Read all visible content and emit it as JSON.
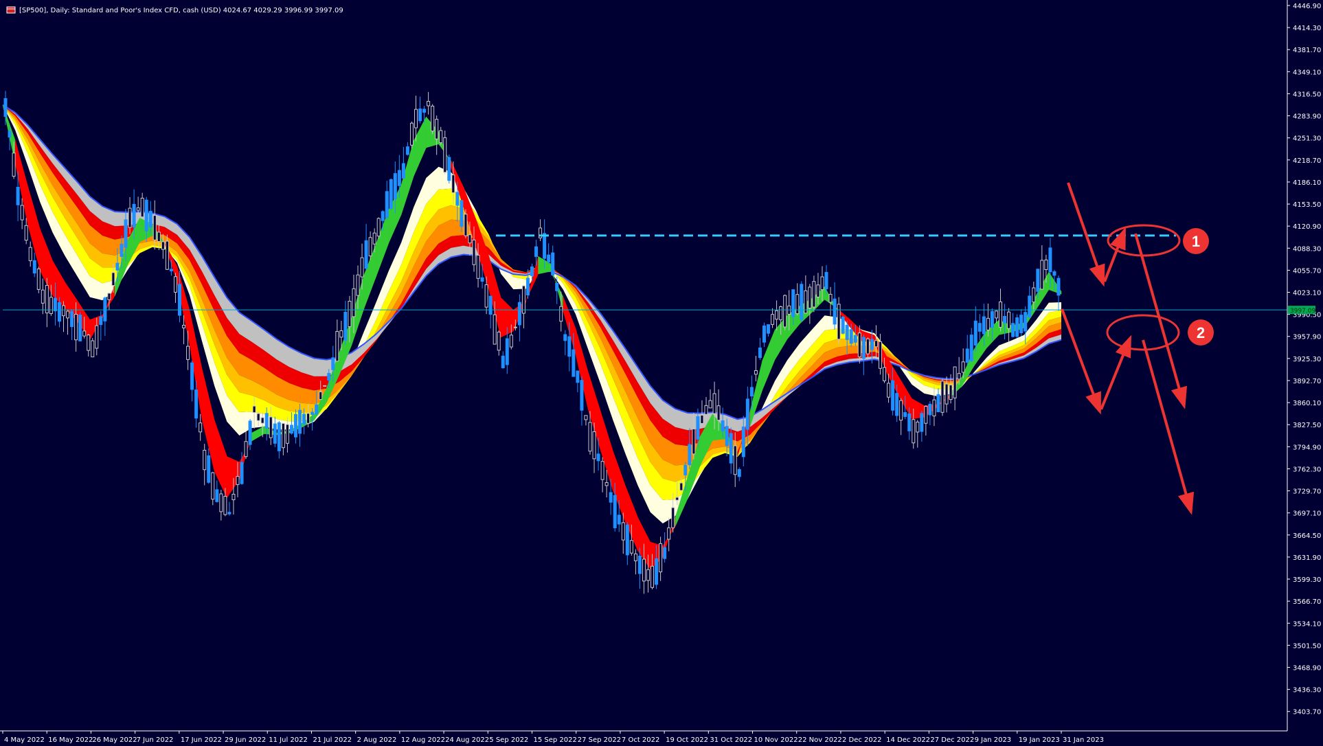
{
  "header": {
    "title": "[SP500], Daily:  Standard and Poor's Index CFD, cash (USD)  4024.67 4029.29 3996.99 3997.09",
    "flag_icon": "chart-window-icon"
  },
  "colors": {
    "background": "#000033",
    "bull_candle": "#1e90ff",
    "bear_candle": "#c8c8c8",
    "axis_text": "#ffffff",
    "cloud_red": "#ff0000",
    "cloud_green": "#33cc33",
    "cloud_pink": "#e040a0",
    "ribbon_gray": "#c0c0c0",
    "ribbon_red": "#ee0000",
    "ribbon_orange": "#ff8c00",
    "ribbon_amber": "#ffc000",
    "ribbon_yellow": "#ffff00",
    "ribbon_cream": "#ffffe0",
    "hline": "#00aacc",
    "dashed": "#33ccff",
    "annotation": "#ee3333",
    "price_tag": "#00aa55"
  },
  "chart_data": {
    "type": "candlestick",
    "symbol": "SP500",
    "timeframe": "Daily",
    "y_axis": {
      "ylim": [
        3375.0,
        4446.9
      ],
      "ticks": [
        "4446.90",
        "4414.30",
        "4381.70",
        "4349.10",
        "4316.50",
        "4283.90",
        "4251.30",
        "4218.70",
        "4186.10",
        "4153.50",
        "4120.90",
        "4088.30",
        "4055.70",
        "4023.10",
        "3990.50",
        "3957.90",
        "3925.30",
        "3892.70",
        "3860.10",
        "3827.50",
        "3794.90",
        "3762.30",
        "3729.70",
        "3697.10",
        "3664.50",
        "3631.90",
        "3599.30",
        "3566.70",
        "3534.10",
        "3501.50",
        "3468.90",
        "3436.30",
        "3403.70"
      ],
      "current_price_label": "3997.09"
    },
    "x_axis": {
      "ticks": [
        "4 May 2022",
        "16 May 2022",
        "26 May 2022",
        "7 Jun 2022",
        "17 Jun 2022",
        "29 Jun 2022",
        "11 Jul 2022",
        "21 Jul 2022",
        "2 Aug 2022",
        "12 Aug 2022",
        "24 Aug 2022",
        "5 Sep 2022",
        "15 Sep 2022",
        "27 Sep 2022",
        "7 Oct 2022",
        "19 Oct 2022",
        "31 Oct 2022",
        "10 Nov 2022",
        "22 Nov 2022",
        "2 Dec 2022",
        "14 Dec 2022",
        "27 Dec 2022",
        "9 Jan 2023",
        "19 Jan 2023",
        "31 Jan 2023"
      ]
    },
    "close_path": [
      4300,
      4170,
      4080,
      4020,
      4000,
      3990,
      3970,
      3940,
      4000,
      4060,
      4130,
      4150,
      4120,
      4080,
      4010,
      3900,
      3780,
      3720,
      3700,
      3760,
      3850,
      3830,
      3810,
      3820,
      3835,
      3850,
      3900,
      3960,
      4010,
      4080,
      4120,
      4170,
      4200,
      4280,
      4300,
      4250,
      4180,
      4120,
      4060,
      4000,
      3920,
      3970,
      4030,
      4110,
      4060,
      3960,
      3900,
      3810,
      3760,
      3700,
      3660,
      3620,
      3600,
      3640,
      3720,
      3780,
      3840,
      3860,
      3810,
      3760,
      3880,
      3960,
      3990,
      4000,
      4010,
      4020,
      4040,
      3980,
      3960,
      3940,
      3950,
      3880,
      3850,
      3820,
      3840,
      3860,
      3880,
      3910,
      3960,
      3980,
      3990,
      3970,
      3980,
      4040,
      4070,
      4010
    ],
    "hline": 3997.09,
    "dashed_level": 4107,
    "annotations": [
      {
        "label": "1"
      },
      {
        "label": "2"
      }
    ]
  }
}
